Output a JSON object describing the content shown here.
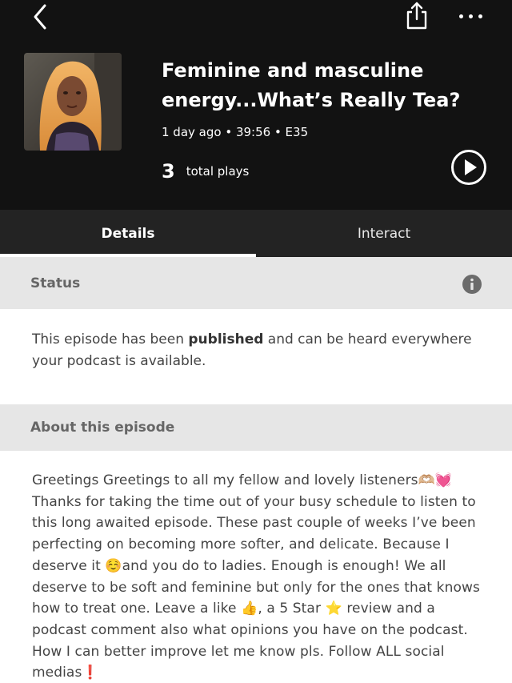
{
  "header": {
    "episode_title": "Feminine and masculine energy...What’s Really Tea?",
    "meta": "1 day ago • 39:56 • E35",
    "plays_count": "3",
    "plays_label": "total plays"
  },
  "tabs": [
    {
      "label": "Details",
      "active": true
    },
    {
      "label": "Interact",
      "active": false
    }
  ],
  "status": {
    "heading": "Status",
    "text_before": "This episode has been ",
    "text_bold": "published",
    "text_after": " and can be heard everywhere your podcast is available."
  },
  "about": {
    "heading": "About this episode",
    "description": "Greetings Greetings to all my fellow and lovely listeners🫶🏼💓 Thanks for taking the time out of your busy schedule to listen to this long awaited episode. These past couple of weeks I’ve been perfecting on becoming more softer, and delicate. Because I deserve it ☺️and you do to ladies. Enough is enough! We all deserve to be soft and feminine but only for the ones that knows how to treat one. Leave a like 👍, a 5 Star ⭐️ review and a podcast comment also what opinions you have on the podcast. How I can better improve let me know pls. Follow ALL social medias❗️"
  },
  "icons": {
    "back": "chevron-left-icon",
    "share": "share-icon",
    "more": "more-horizontal-icon",
    "play": "play-circle-icon",
    "info": "info-icon"
  },
  "colors": {
    "header_bg": "#121212",
    "tab_bar_bg": "#232323",
    "section_head_bg": "#e6e6e6",
    "body_text": "#444444"
  }
}
